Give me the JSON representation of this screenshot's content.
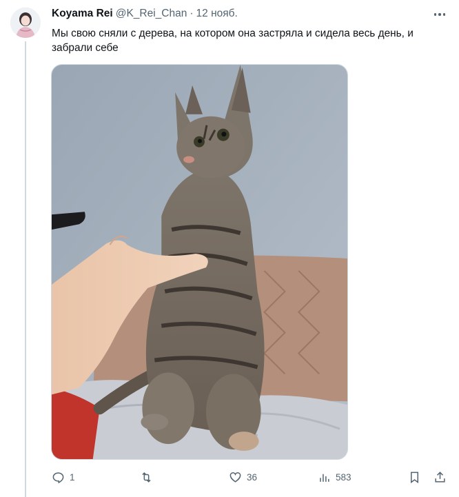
{
  "tweet": {
    "display_name": "Koyama Rei",
    "handle": "@K_Rei_Chan",
    "separator": "·",
    "date": "12 нояб.",
    "text": "Мы свою сняли с дерева, на котором она застряла и сидела весь день, и забрали себе",
    "media": {
      "alt": ""
    }
  },
  "actions": {
    "reply": {
      "icon": "reply-icon",
      "count": "1"
    },
    "retweet": {
      "icon": "retweet-icon",
      "count": ""
    },
    "like": {
      "icon": "heart-icon",
      "count": "36"
    },
    "views": {
      "icon": "views-icon",
      "count": "583"
    },
    "bookmark": {
      "icon": "bookmark-icon"
    },
    "share": {
      "icon": "share-icon"
    }
  },
  "colors": {
    "text": "#0f1419",
    "secondary": "#536471",
    "border": "#cfd9de"
  }
}
